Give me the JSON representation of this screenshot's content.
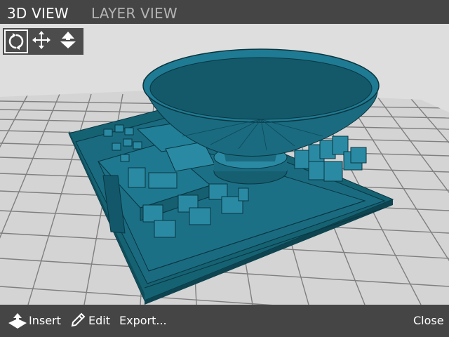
{
  "tabs": [
    {
      "label": "3D VIEW",
      "active": true
    },
    {
      "label": "LAYER VIEW",
      "active": false
    }
  ],
  "view_tools": [
    {
      "name": "rotate",
      "icon": "rotate-icon",
      "selected": true
    },
    {
      "name": "pan",
      "icon": "move-arrows-icon",
      "selected": false
    },
    {
      "name": "zoom",
      "icon": "zoom-arrows-icon",
      "selected": false
    }
  ],
  "bottom_bar": {
    "insert_label": "Insert",
    "edit_label": "Edit",
    "export_label": "Export...",
    "close_label": "Close"
  },
  "colors": {
    "bar_background": "#454545",
    "model_teal": "#1a6b80",
    "grid_background": "#dcdcdc"
  }
}
